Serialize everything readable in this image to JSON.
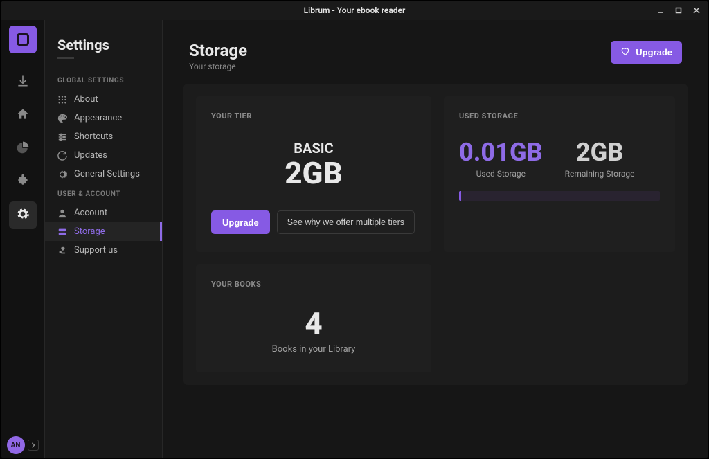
{
  "window": {
    "title": "Librum - Your ebook reader"
  },
  "rail": {
    "avatar_initials": "AN"
  },
  "sidebar": {
    "title": "Settings",
    "groups": {
      "global": {
        "label": "GLOBAL SETTINGS",
        "items": [
          "About",
          "Appearance",
          "Shortcuts",
          "Updates",
          "General Settings"
        ]
      },
      "user": {
        "label": "USER & ACCOUNT",
        "items": [
          "Account",
          "Storage",
          "Support us"
        ]
      }
    }
  },
  "page": {
    "title": "Storage",
    "subtitle": "Your storage",
    "upgrade_label": "Upgrade"
  },
  "tier": {
    "label": "YOUR TIER",
    "name": "BASIC",
    "size": "2GB",
    "upgrade_label": "Upgrade",
    "why_label": "See why we offer multiple tiers"
  },
  "used": {
    "label": "USED STORAGE",
    "used_value": "0.01GB",
    "used_sub": "Used Storage",
    "remaining_value": "2GB",
    "remaining_sub": "Remaining Storage"
  },
  "books": {
    "label": "YOUR BOOKS",
    "count": "4",
    "sub": "Books in your Library"
  }
}
